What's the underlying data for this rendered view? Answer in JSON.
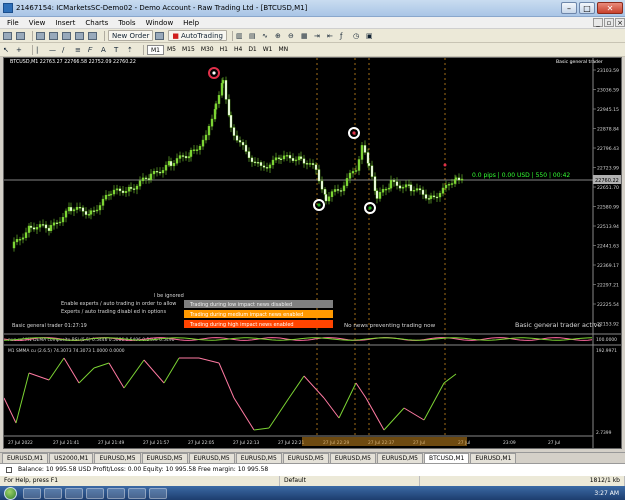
{
  "window": {
    "title": "21467154: ICMarketsSC-Demo02 - Demo Account - Raw Trading Ltd - [BTCUSD,M1]"
  },
  "menu": [
    "File",
    "View",
    "Insert",
    "Charts",
    "Tools",
    "Window",
    "Help"
  ],
  "toolbar": {
    "new_order": "New Order",
    "autotrading": "AutoTrading",
    "timeframes": [
      "M1",
      "M5",
      "M15",
      "M30",
      "H1",
      "H4",
      "D1",
      "W1",
      "MN"
    ],
    "active_timeframe": "M1"
  },
  "chart": {
    "header": "BTCUSD,M1  22763.27 22766.58 22752.09 22760.22",
    "ea_corner": "Basic general trader",
    "info_line": "0.0 pips | 0.00 USD | 550 | 00:42",
    "price_axis": [
      "23103.59",
      "23036.59",
      "22945.15",
      "22878.84",
      "22796.43",
      "22723.99",
      "22651.70",
      "22580.99",
      "22513.94",
      "22441.63",
      "22369.17",
      "22297.21",
      "22225.54",
      "22153.92"
    ],
    "current_price": "22760.22",
    "bottom_status": "Basic general trader active",
    "news_status": "No news preventing trading now",
    "ignored_note": "l be ignored",
    "enable_msg_1": "Enable experts / auto trading in order to allow",
    "enable_msg_2": "Experts / auto trading disabl ed in options",
    "spread_msg": "Basic general trader  01:27:19",
    "news_low": "Trading during low impact news disabled",
    "news_med": "Trading during medium impact news enabled",
    "news_high": "Trading during high impact news enabled",
    "colors": {
      "low": "#808080",
      "medium": "#ff9900",
      "high": "#ff4400",
      "line": "#7cd434",
      "info": "#33ff33"
    }
  },
  "indicator1": {
    "label": "nue-ref M1 DEMA composite RSI (5.5) 0.5446 0.5086 0.5496 0.5496 0.5496",
    "axis": "100.0000"
  },
  "indicator2": {
    "label": "M1 SMMA cu (2.6.5)  74.3073 74.3073 1.0000 0.0000",
    "axis_top": "192.9971",
    "axis_bottom": "2.7399"
  },
  "time_axis": [
    "27 Jul 2022",
    "27 Jul 21:41",
    "27 Jul 21:49",
    "27 Jul 21:57",
    "27 Jul 22:05",
    "27 Jul 22:13",
    "27 Jul 22:21",
    "27 Jul 22:29",
    "27 Jul 22:37",
    "27 Jul",
    "27 Jul",
    "23:09",
    "27 Jul"
  ],
  "symbol_tabs": [
    "EURUSD,M1",
    "US2000,M1",
    "EURUSD,M5",
    "EURUSD,M5",
    "EURUSD,M5",
    "EURUSD,M5",
    "EURUSD,M5",
    "EURUSD,M5",
    "EURUSD,M5",
    "BTCUSD,M1",
    "EURUSD,M1"
  ],
  "active_symbol_tab": "BTCUSD,M1",
  "trade_panel": "Balance: 10 995.58 USD  Profit/Loss: 0.00  Equity: 10 995.58  Free margin: 10 995.58",
  "status": {
    "help": "For Help, press F1",
    "profile": "Default",
    "conn": "1812/1 kb"
  },
  "taskbar": {
    "clock": "3:27 AM"
  }
}
